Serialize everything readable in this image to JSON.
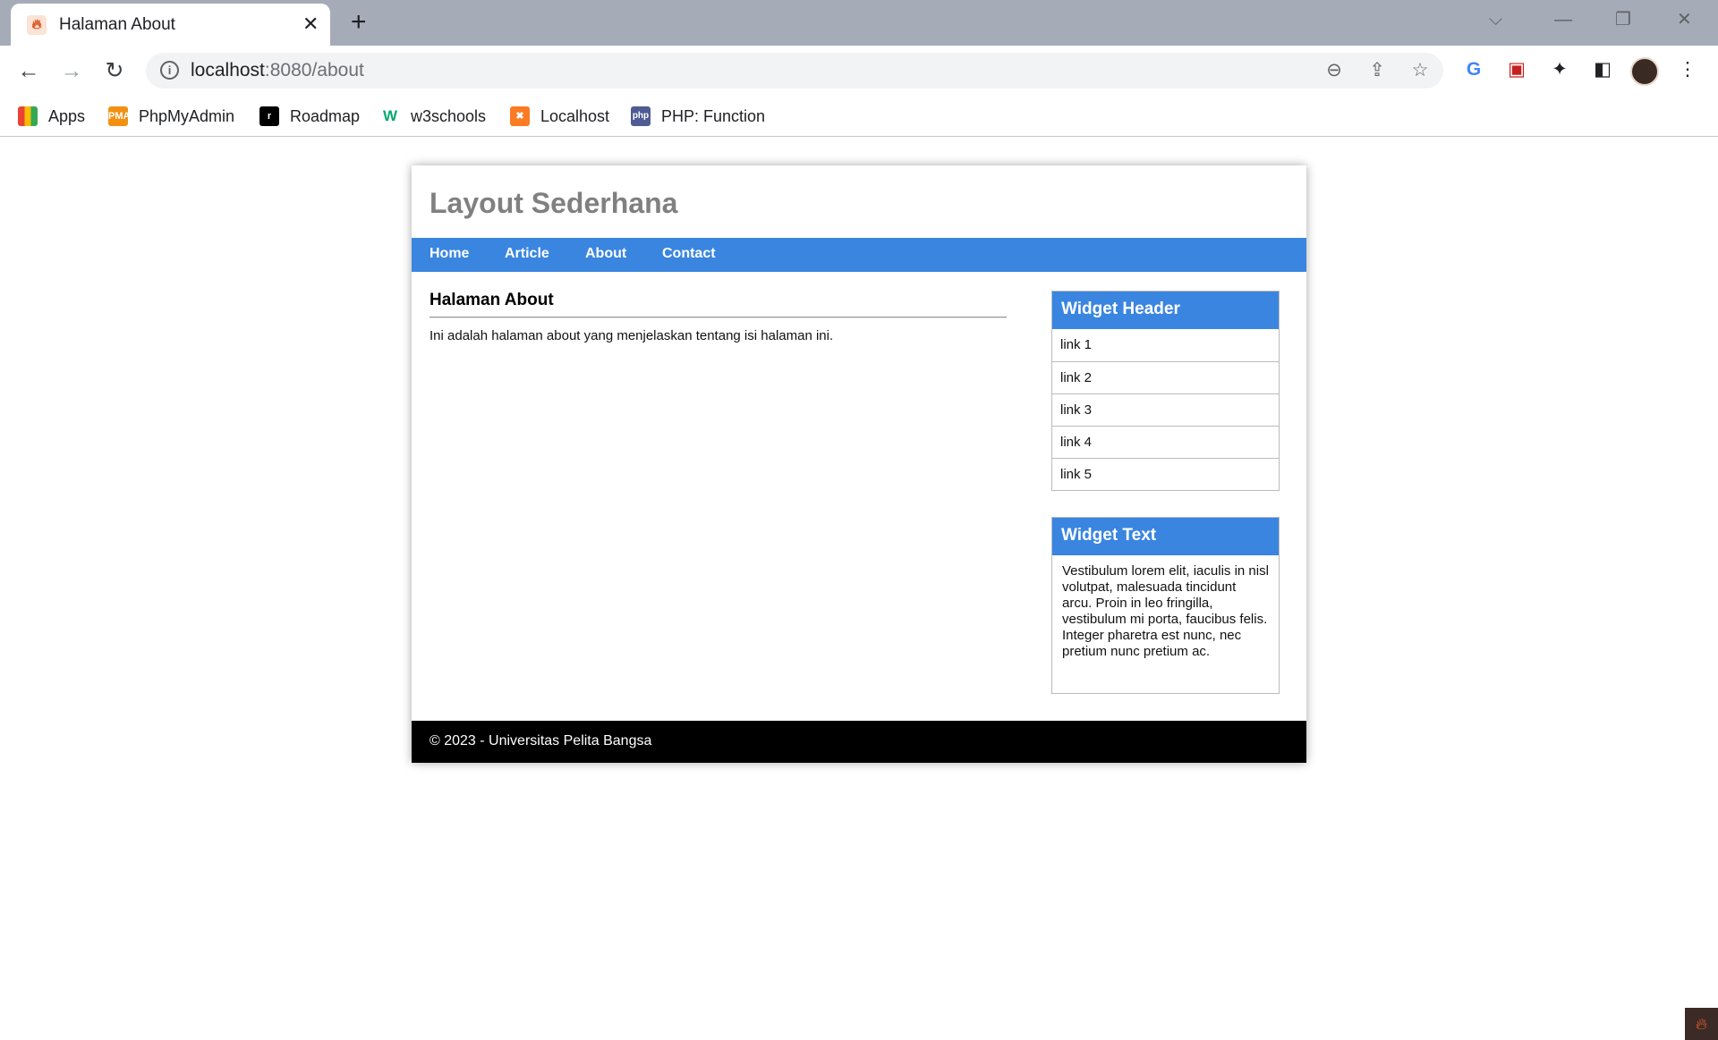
{
  "browser": {
    "tab": {
      "title": "Halaman About",
      "close": "✕"
    },
    "new_tab": "+",
    "window": {
      "minimize": "—",
      "restore": "❐",
      "close": "✕",
      "tab_search": "⌵"
    },
    "nav": {
      "back": "←",
      "forward": "→",
      "reload": "↻"
    },
    "address": {
      "host": "localhost",
      "path": ":8080/about"
    },
    "bookmarks": [
      {
        "label": "Apps",
        "icon": "apps-grid-icon",
        "color": "#ea4335"
      },
      {
        "label": "PhpMyAdmin",
        "icon": "phpmyadmin-icon",
        "color": "#f29111"
      },
      {
        "label": "Roadmap",
        "icon": "roadmap-icon",
        "color": "#000000"
      },
      {
        "label": "w3schools",
        "icon": "w3schools-icon",
        "color": "#04aa6d"
      },
      {
        "label": "Localhost",
        "icon": "xampp-icon",
        "color": "#fb7a24"
      },
      {
        "label": "PHP: Function",
        "icon": "php-icon",
        "color": "#4f5b93"
      }
    ]
  },
  "page": {
    "site_title": "Layout Sederhana",
    "nav": [
      "Home",
      "Article",
      "About",
      "Contact"
    ],
    "main": {
      "title": "Halaman About",
      "text": "Ini adalah halaman about yang menjelaskan tentang isi halaman ini."
    },
    "widget_links": {
      "title": "Widget Header",
      "links": [
        "link 1",
        "link 2",
        "link 3",
        "link 4",
        "link 5"
      ]
    },
    "widget_text": {
      "title": "Widget Text",
      "body": "Vestibulum lorem elit, iaculis in nisl volutpat, malesuada tincidunt arcu. Proin in leo fringilla, vestibulum mi porta, faucibus felis. Integer pharetra est nunc, nec pretium nunc pretium ac."
    },
    "footer": "© 2023 - Universitas Pelita Bangsa"
  },
  "colors": {
    "nav_bg": "#3a85e0",
    "footer_bg": "#000000",
    "title_gray": "#808080"
  }
}
